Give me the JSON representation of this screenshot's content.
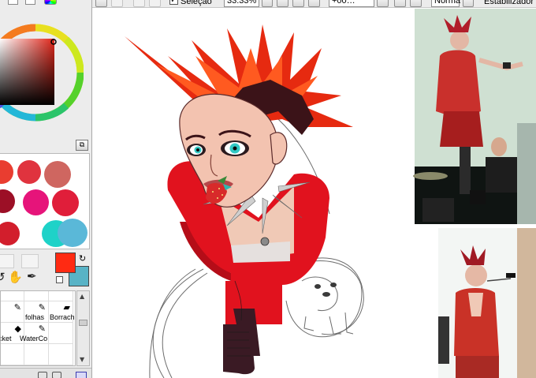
{
  "toolbar": {
    "selection_label": "Seleção",
    "zoom_value": "33.33%",
    "rotation_value": "+00…",
    "blend_mode": "Norma",
    "stabilizer_label": "Estabilizador"
  },
  "tools": {
    "row2": [
      "folhas",
      "Borrach"
    ],
    "row3": [
      "icket",
      "WaterCo"
    ]
  },
  "colors": {
    "foreground": "#ff2a12",
    "background": "#58b3c6"
  },
  "icons": [
    "list-icon",
    "grid-icon",
    "color-wheel-icon",
    "hand-icon",
    "eyedropper-icon",
    "swap-colors-icon",
    "brush-icon",
    "eraser-icon"
  ]
}
